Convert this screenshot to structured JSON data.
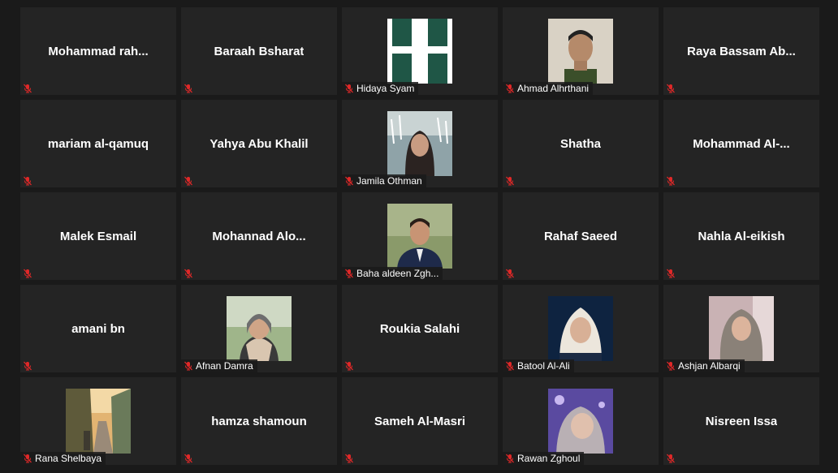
{
  "colors": {
    "background": "#1a1a1a",
    "tile": "#242424",
    "muted_mic": "#e02828",
    "text": "#ffffff"
  },
  "participants": [
    {
      "name": "Mohammad  rah...",
      "video": false,
      "muted": true
    },
    {
      "name": "Baraah Bsharat",
      "video": false,
      "muted": true
    },
    {
      "name": "Hidaya Syam",
      "video": true,
      "muted": true,
      "thumb": "logo"
    },
    {
      "name": "Ahmad Alhrthani",
      "video": true,
      "muted": true,
      "thumb": "man-beige"
    },
    {
      "name": "Raya Bassam Ab...",
      "video": false,
      "muted": true
    },
    {
      "name": "mariam al-qamuq",
      "video": false,
      "muted": true
    },
    {
      "name": "Yahya Abu Khalil",
      "video": false,
      "muted": true
    },
    {
      "name": "Jamila Othman",
      "video": true,
      "muted": true,
      "thumb": "woman-fountain"
    },
    {
      "name": "Shatha",
      "video": false,
      "muted": true
    },
    {
      "name": "Mohammad  Al-...",
      "video": false,
      "muted": true
    },
    {
      "name": "Malek Esmail",
      "video": false,
      "muted": true
    },
    {
      "name": "Mohannad  Alo...",
      "video": false,
      "muted": true
    },
    {
      "name": "Baha aldeen Zgh...",
      "video": true,
      "muted": true,
      "thumb": "man-suit"
    },
    {
      "name": "Rahaf Saeed",
      "video": false,
      "muted": true
    },
    {
      "name": "Nahla Al-eikish",
      "video": false,
      "muted": true
    },
    {
      "name": "amani bn",
      "video": false,
      "muted": true
    },
    {
      "name": "Afnan Damra",
      "video": true,
      "muted": true,
      "thumb": "woman-park"
    },
    {
      "name": "Roukia Salahi",
      "video": false,
      "muted": true
    },
    {
      "name": "Batool Al-Ali",
      "video": true,
      "muted": true,
      "thumb": "woman-dark"
    },
    {
      "name": "Ashjan Albarqi",
      "video": true,
      "muted": true,
      "thumb": "woman-window"
    },
    {
      "name": "Rana Shelbaya",
      "video": true,
      "muted": true,
      "thumb": "street"
    },
    {
      "name": "hamza shamoun",
      "video": false,
      "muted": true
    },
    {
      "name": "Sameh Al-Masri",
      "video": false,
      "muted": true
    },
    {
      "name": "Rawan Zghoul",
      "video": true,
      "muted": true,
      "thumb": "woman-purple"
    },
    {
      "name": "Nisreen Issa",
      "video": false,
      "muted": true
    }
  ]
}
